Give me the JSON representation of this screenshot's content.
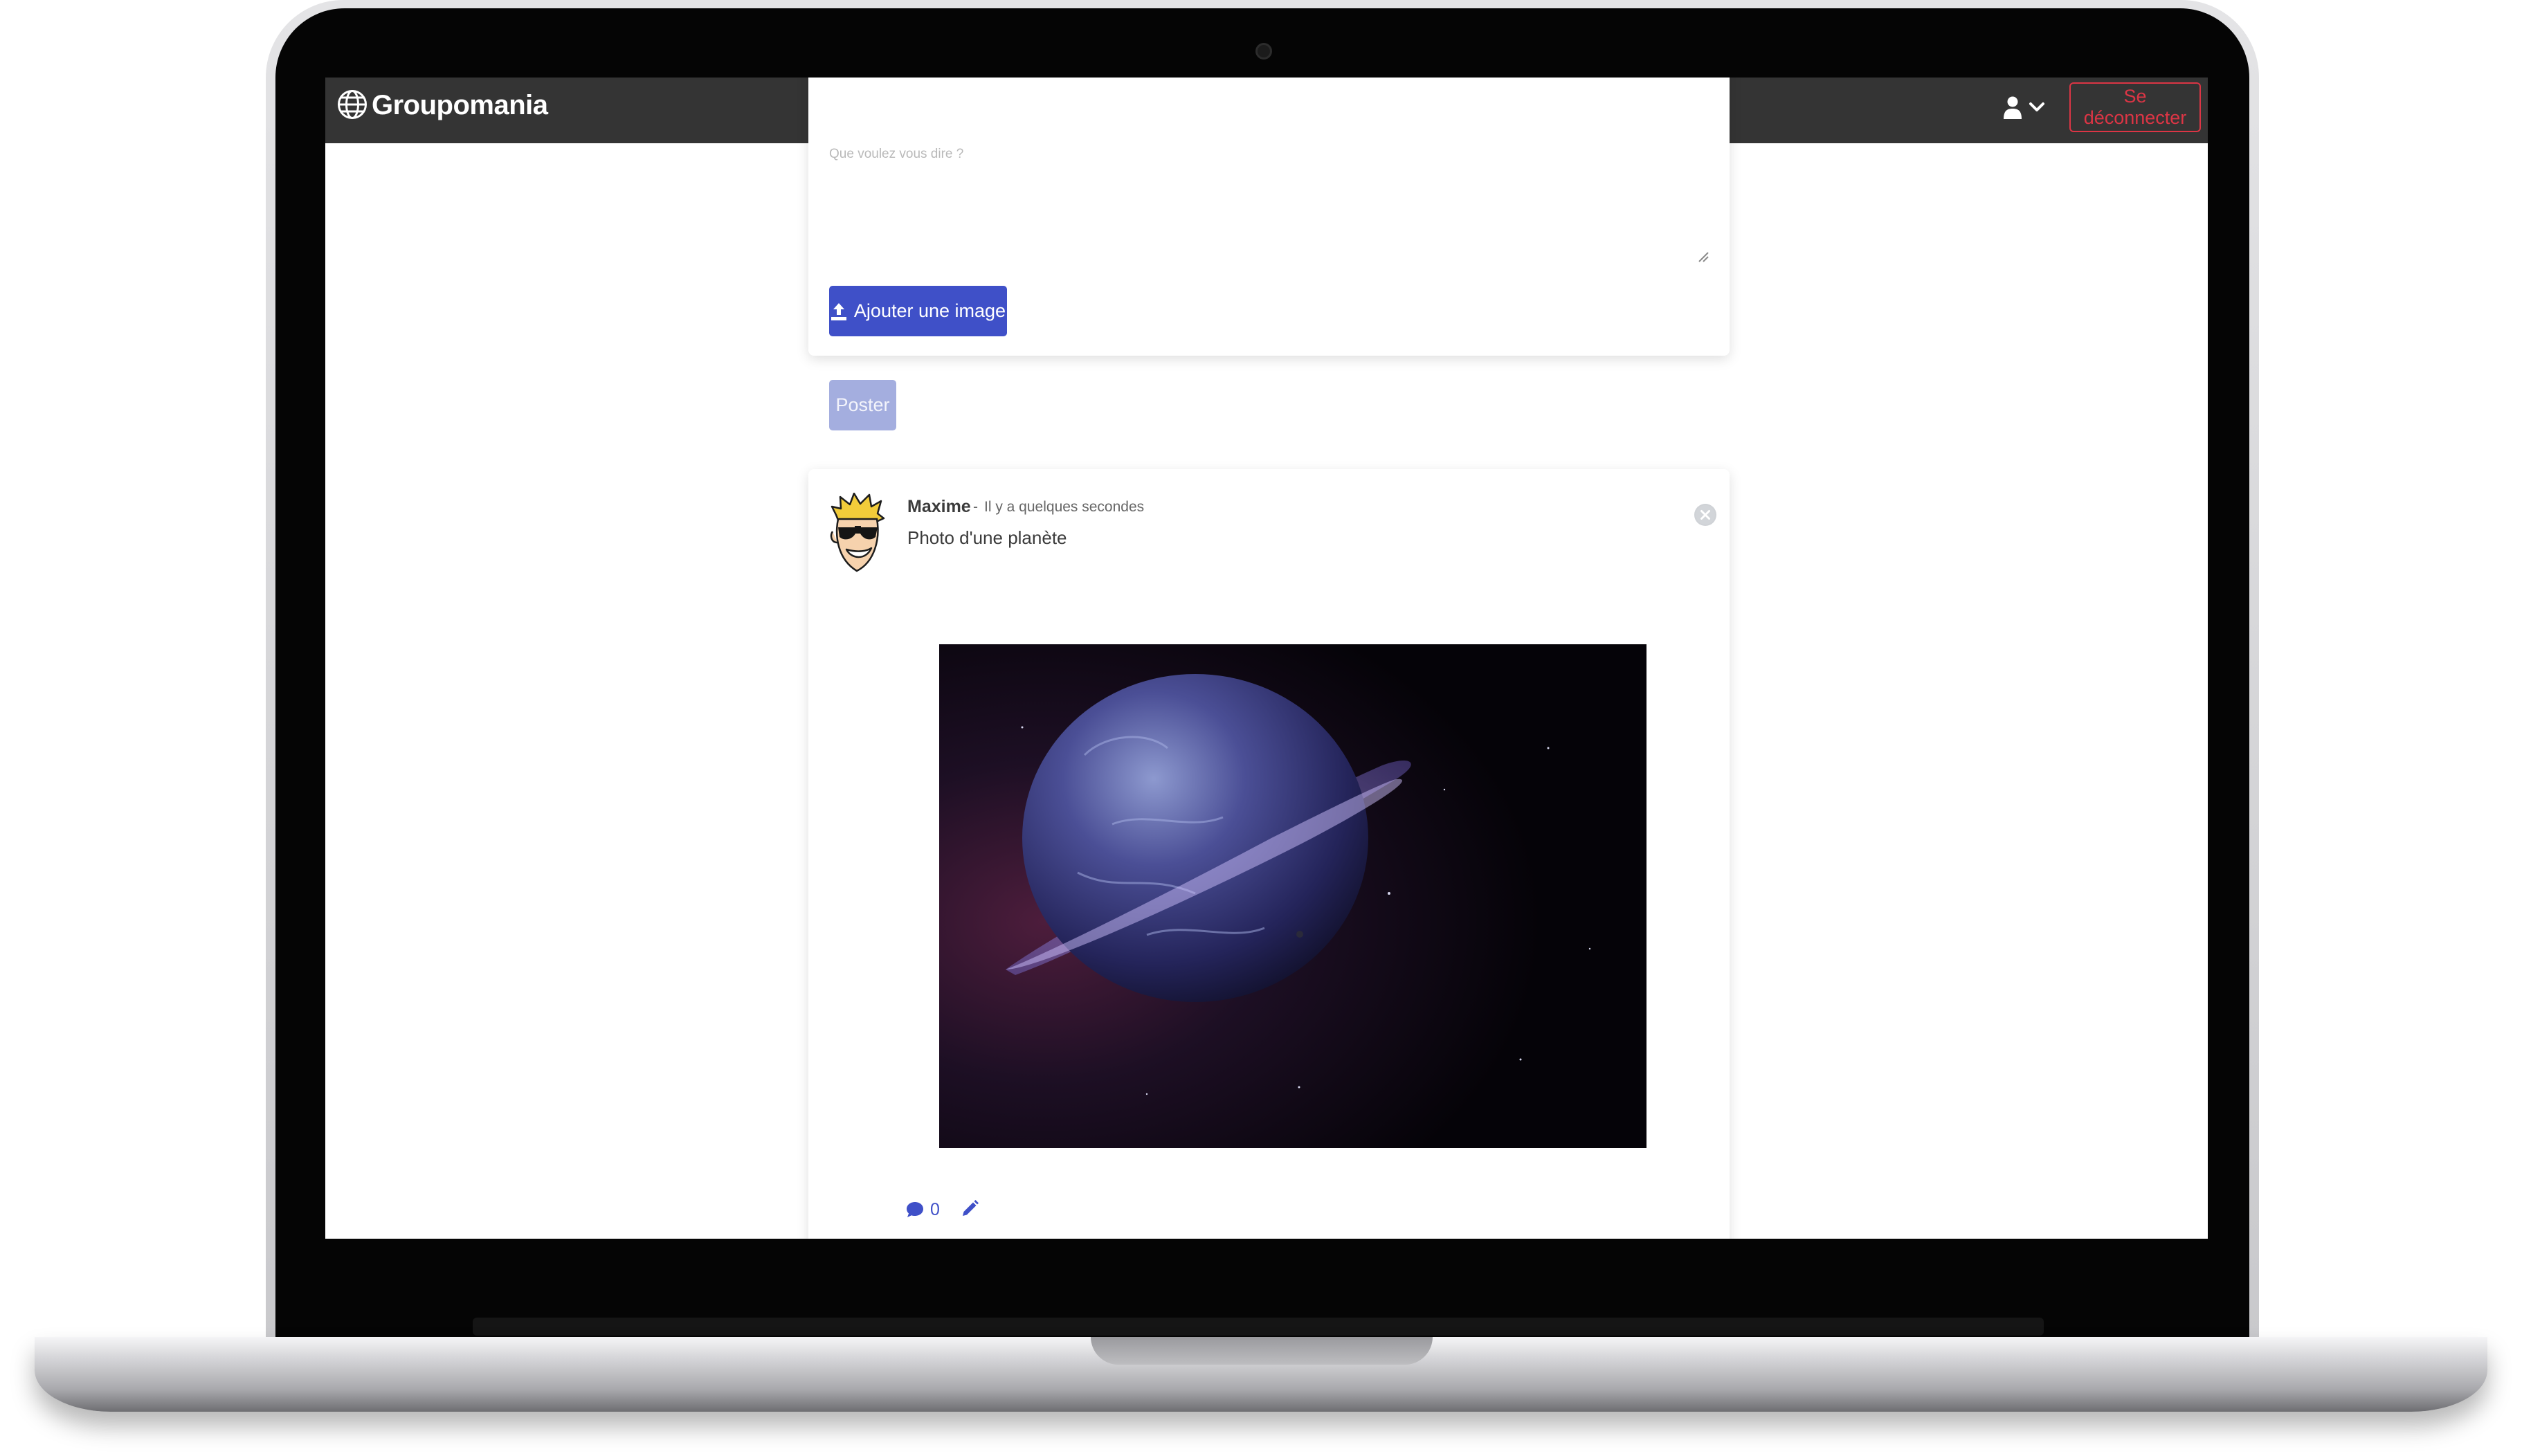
{
  "app": {
    "brand_name": "Groupomania"
  },
  "navbar": {
    "user_menu_icon": "user-icon",
    "user_menu_chevron": "chevron-down-icon",
    "logout_label": "Se déconnecter",
    "logout_color": "#dc3545",
    "background_color": "#343434"
  },
  "composer": {
    "placeholder": "Que voulez vous dire ?",
    "add_image_label": "Ajouter une image",
    "add_image_icon": "upload-icon",
    "post_label": "Poster",
    "accent_color": "#3f50c8"
  },
  "posts": [
    {
      "author": "Maxime",
      "separator": "-",
      "time": "Il y a quelques secondes",
      "text": "Photo d'une planète",
      "image_alt": "Planète avec anneaux",
      "comment_count": "0",
      "comment_icon": "comment-icon",
      "edit_icon": "pencil-icon",
      "delete_icon": "close-icon"
    }
  ]
}
